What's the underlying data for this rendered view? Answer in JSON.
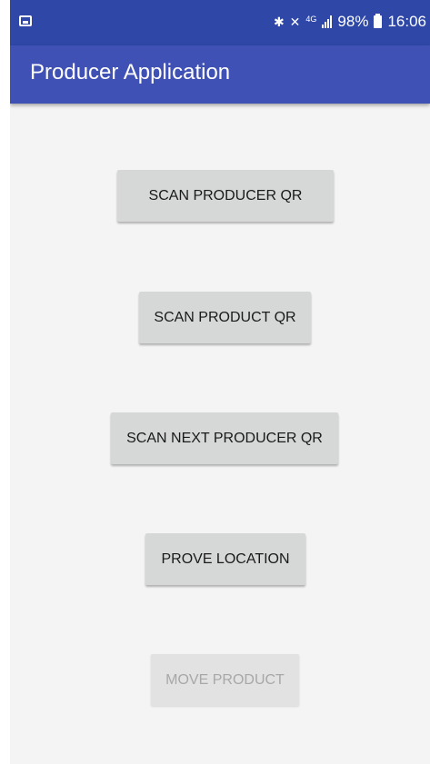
{
  "status_bar": {
    "notification_icon": "image-notification-icon",
    "bluetooth_icon": "bluetooth-icon",
    "mute_icon": "vibrate-mute-icon",
    "network_type": "4G",
    "signal_icon": "signal-strength-icon",
    "battery_percent": "98%",
    "battery_icon": "battery-icon",
    "time": "16:06"
  },
  "app_bar": {
    "title": "Producer Application",
    "color": "#3f51b5"
  },
  "buttons": [
    {
      "label": "SCAN PRODUCER QR",
      "enabled": true
    },
    {
      "label": "SCAN PRODUCT QR",
      "enabled": true
    },
    {
      "label": "SCAN NEXT PRODUCER QR",
      "enabled": true
    },
    {
      "label": "PROVE LOCATION",
      "enabled": true
    },
    {
      "label": "MOVE PRODUCT",
      "enabled": false
    }
  ]
}
